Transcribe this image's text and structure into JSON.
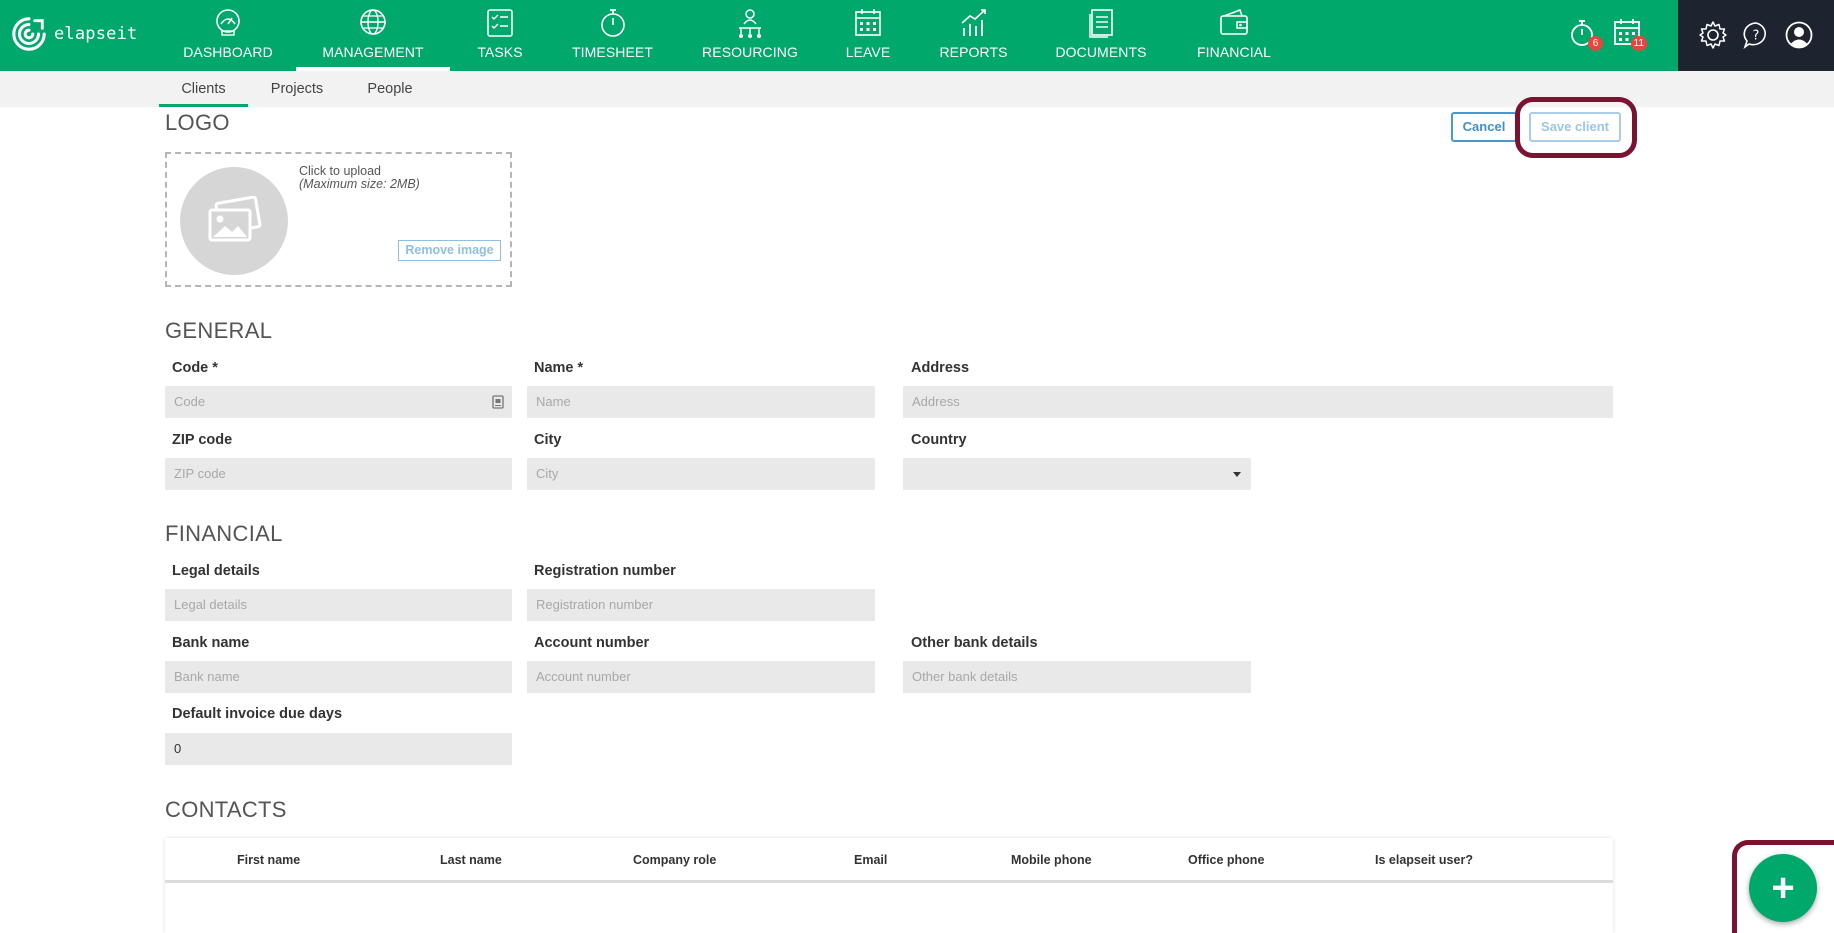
{
  "brand": {
    "name": "elapseit"
  },
  "nav": {
    "items": [
      {
        "label": "DASHBOARD",
        "icon": "dashboard-icon"
      },
      {
        "label": "MANAGEMENT",
        "icon": "globe-icon",
        "active": true
      },
      {
        "label": "TASKS",
        "icon": "tasks-icon"
      },
      {
        "label": "TIMESHEET",
        "icon": "stopwatch-icon"
      },
      {
        "label": "RESOURCING",
        "icon": "resourcing-icon"
      },
      {
        "label": "LEAVE",
        "icon": "calendar-icon"
      },
      {
        "label": "REPORTS",
        "icon": "chart-icon"
      },
      {
        "label": "DOCUMENTS",
        "icon": "documents-icon"
      },
      {
        "label": "FINANCIAL",
        "icon": "wallet-icon"
      }
    ],
    "notifications": [
      {
        "icon": "timer-alert-icon",
        "count": "6"
      },
      {
        "icon": "calendar-alert-icon",
        "count": "11"
      }
    ],
    "utility_icons": [
      "settings-icon",
      "help-icon",
      "user-icon"
    ]
  },
  "subnav": {
    "tabs": [
      {
        "label": "Clients",
        "active": true
      },
      {
        "label": "Projects"
      },
      {
        "label": "People"
      }
    ]
  },
  "actions": {
    "cancel": "Cancel",
    "save": "Save client"
  },
  "logo_section": {
    "title": "LOGO",
    "upload_text": "Click to upload",
    "upload_sub": "(Maximum size: 2MB)",
    "remove": "Remove image"
  },
  "general": {
    "title": "GENERAL",
    "code": {
      "label": "Code *",
      "placeholder": "Code",
      "value": ""
    },
    "name": {
      "label": "Name *",
      "placeholder": "Name",
      "value": ""
    },
    "address": {
      "label": "Address",
      "placeholder": "Address",
      "value": ""
    },
    "zip": {
      "label": "ZIP code",
      "placeholder": "ZIP code",
      "value": ""
    },
    "city": {
      "label": "City",
      "placeholder": "City",
      "value": ""
    },
    "country": {
      "label": "Country",
      "value": ""
    }
  },
  "financial": {
    "title": "FINANCIAL",
    "legal": {
      "label": "Legal details",
      "placeholder": "Legal details"
    },
    "registration": {
      "label": "Registration number",
      "placeholder": "Registration number"
    },
    "bank": {
      "label": "Bank name",
      "placeholder": "Bank name"
    },
    "account": {
      "label": "Account number",
      "placeholder": "Account number"
    },
    "other_bank": {
      "label": "Other bank details",
      "placeholder": "Other bank details"
    },
    "due_days": {
      "label": "Default invoice due days",
      "value": "0"
    }
  },
  "contacts": {
    "title": "CONTACTS",
    "columns": [
      "First name",
      "Last name",
      "Company role",
      "Email",
      "Mobile phone",
      "Office phone",
      "Is elapseit user?"
    ],
    "rows": []
  },
  "fab": {
    "symbol": "+"
  },
  "colors": {
    "brand_green": "#00a86b",
    "dark_panel": "#1d2430",
    "highlight": "#7b1230",
    "link_blue": "#3f8fce"
  }
}
